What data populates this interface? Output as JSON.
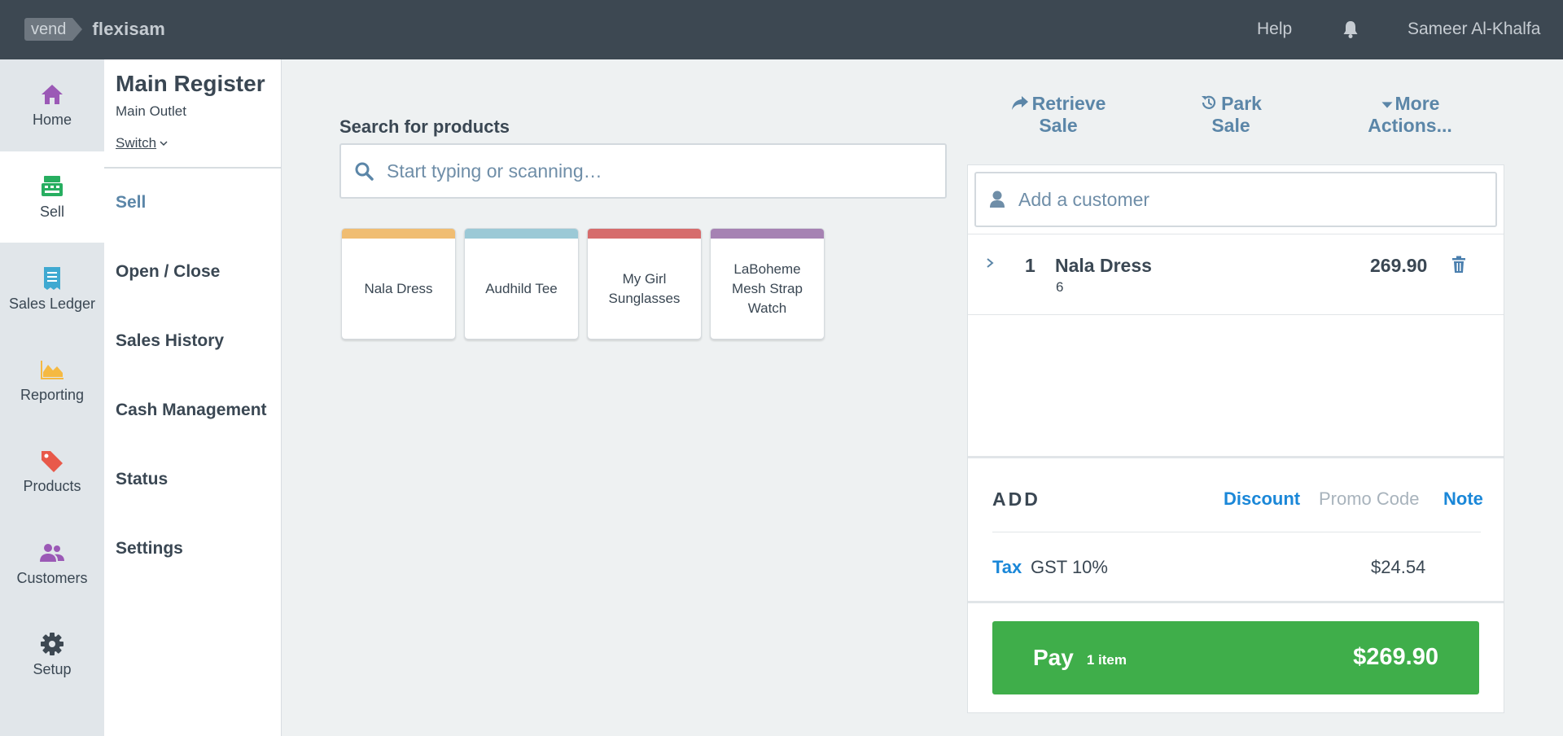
{
  "header": {
    "logo_text": "vend",
    "store_name": "flexisam",
    "help_label": "Help",
    "notifications_icon": "bell-icon",
    "user_name": "Sameer Al-Khalfa"
  },
  "rail": {
    "items": [
      {
        "label": "Home",
        "icon": "home-icon",
        "color": "#9b59b6"
      },
      {
        "label": "Sell",
        "icon": "register-icon",
        "color": "#27ae60",
        "active": true
      },
      {
        "label": "Sales Ledger",
        "icon": "receipt-icon",
        "color": "#3fa9d1"
      },
      {
        "label": "Reporting",
        "icon": "chart-icon",
        "color": "#f5b942"
      },
      {
        "label": "Products",
        "icon": "tags-icon",
        "color": "#e8594a"
      },
      {
        "label": "Customers",
        "icon": "users-icon",
        "color": "#9b59b6"
      },
      {
        "label": "Setup",
        "icon": "gear-icon",
        "color": "#3d4852"
      }
    ]
  },
  "register": {
    "title": "Main Register",
    "outlet": "Main Outlet",
    "switch_label": "Switch"
  },
  "subnav": {
    "items": [
      {
        "label": "Sell",
        "active": true
      },
      {
        "label": "Open / Close"
      },
      {
        "label": "Sales History"
      },
      {
        "label": "Cash Management"
      },
      {
        "label": "Status"
      },
      {
        "label": "Settings"
      }
    ]
  },
  "search": {
    "label": "Search for products",
    "placeholder": "Start typing or scanning…"
  },
  "quick_keys": [
    {
      "label": "Nala Dress",
      "color": "#f0bd72"
    },
    {
      "label": "Audhild Tee",
      "color": "#9bc9d6"
    },
    {
      "label": "My Girl Sunglasses",
      "color": "#d66c6c"
    },
    {
      "label": "LaBoheme Mesh Strap Watch",
      "color": "#a682b3"
    }
  ],
  "actions": {
    "retrieve": {
      "line1": "Retrieve",
      "line2": "Sale"
    },
    "park": {
      "line1": "Park",
      "line2": "Sale"
    },
    "more": {
      "line1": "More",
      "line2": "Actions..."
    }
  },
  "sale": {
    "customer_placeholder": "Add a customer",
    "line_items": [
      {
        "qty": "1",
        "name": "Nala Dress",
        "sub": "6",
        "price": "269.90"
      }
    ],
    "add": {
      "label": "ADD",
      "discount": "Discount",
      "promo_code": "Promo Code",
      "note": "Note"
    },
    "tax": {
      "label": "Tax",
      "rate": "GST 10%",
      "amount": "$24.54"
    },
    "pay": {
      "label": "Pay",
      "count": "1 item",
      "total": "$269.90"
    }
  },
  "colors": {
    "topbar": "#3d4852",
    "accent_blue": "#1a87d8",
    "link_blue": "#5b86a8",
    "pay_green": "#3fae4a"
  }
}
